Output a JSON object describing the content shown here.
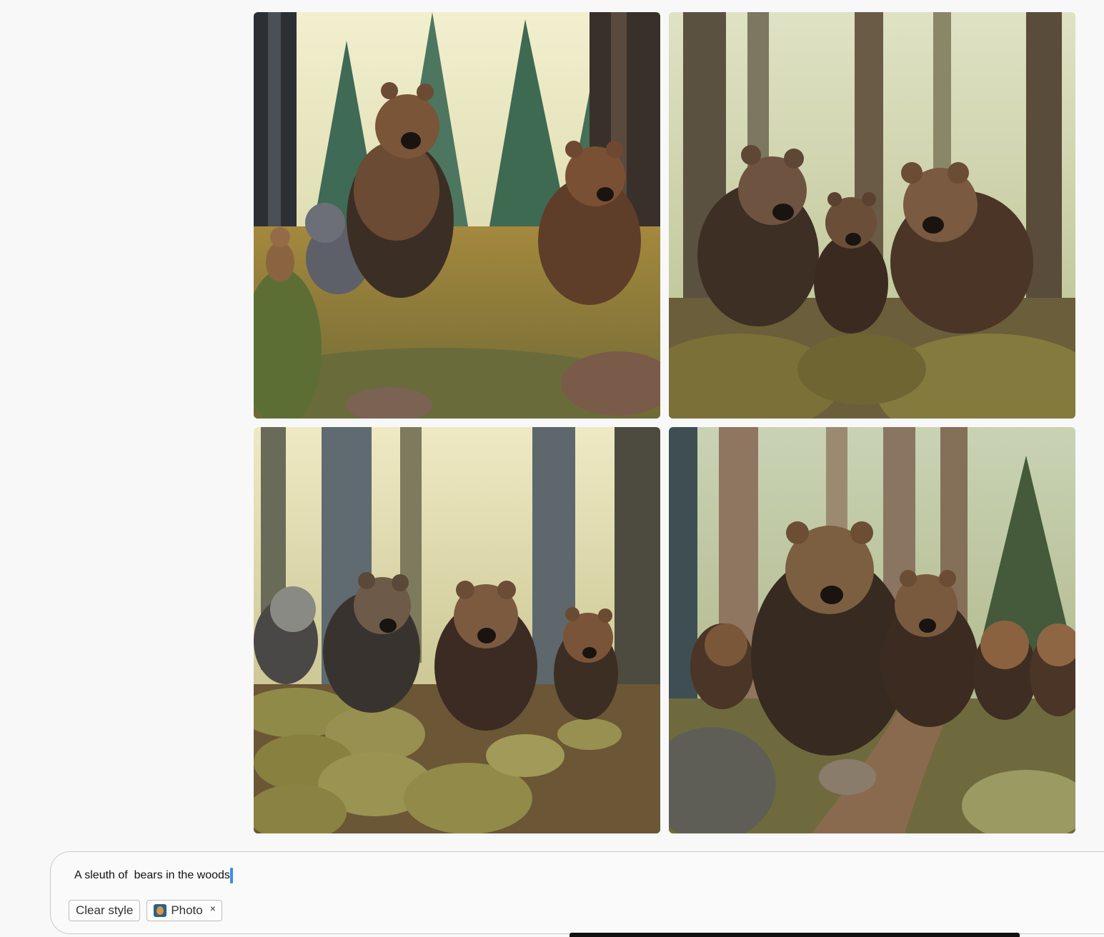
{
  "gallery": {
    "images": [
      {
        "name": "generated-image-1",
        "alt": ""
      },
      {
        "name": "generated-image-2",
        "alt": ""
      },
      {
        "name": "generated-image-3",
        "alt": ""
      },
      {
        "name": "generated-image-4",
        "alt": ""
      }
    ]
  },
  "prompt": {
    "text": "A sleuth of  bears in the woods"
  },
  "styles": {
    "clear_label": "Clear style",
    "applied": [
      {
        "label": "Photo",
        "icon": "photo-style-thumbnail",
        "remove_icon": "×"
      }
    ]
  },
  "colors": {
    "caret": "#3a8ef0",
    "background": "#f8f8f8",
    "border": "#c9c9c9"
  }
}
